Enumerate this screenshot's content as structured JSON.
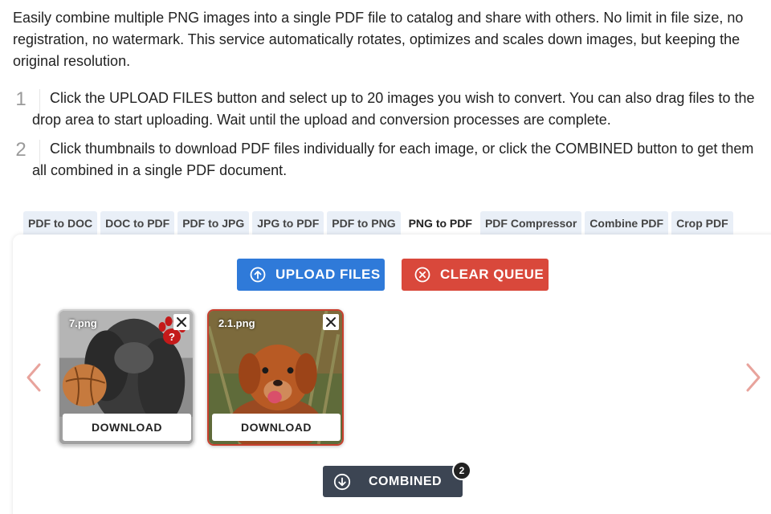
{
  "intro": "Easily combine multiple PNG images into a single PDF file to catalog and share with others. No limit in file size, no registration, no watermark. This service automatically rotates, optimizes and scales down images, but keeping the original resolution.",
  "steps": [
    {
      "num": "1",
      "text": "Click the UPLOAD FILES button and select up to 20 images you wish to convert. You can also drag files to the drop area to start uploading. Wait until the upload and conversion processes are complete."
    },
    {
      "num": "2",
      "text": "Click thumbnails to download PDF files individually for each image, or click the COMBINED button to get them all combined in a single PDF document."
    }
  ],
  "tabs": [
    {
      "label": "PDF to DOC",
      "active": false
    },
    {
      "label": "DOC to PDF",
      "active": false
    },
    {
      "label": "PDF to JPG",
      "active": false
    },
    {
      "label": "JPG to PDF",
      "active": false
    },
    {
      "label": "PDF to PNG",
      "active": false
    },
    {
      "label": "PNG to PDF",
      "active": true
    },
    {
      "label": "PDF Compressor",
      "active": false
    },
    {
      "label": "Combine PDF",
      "active": false
    },
    {
      "label": "Crop PDF",
      "active": false
    }
  ],
  "buttons": {
    "upload": {
      "label": "UPLOAD FILES",
      "icon": "upload-circle-icon",
      "color": "#2f7ad9"
    },
    "clear": {
      "label": "CLEAR QUEUE",
      "icon": "close-circle-icon",
      "color": "#d9483b"
    },
    "combined": {
      "label": "COMBINED",
      "icon": "download-circle-icon",
      "color": "#3c4553",
      "badge": "2"
    }
  },
  "files": [
    {
      "name": "7.png",
      "download_label": "DOWNLOAD",
      "status_icon": "paw-question-icon"
    },
    {
      "name": "2.1.png",
      "download_label": "DOWNLOAD"
    }
  ],
  "nav": {
    "prev_icon": "chevron-left-icon",
    "next_icon": "chevron-right-icon"
  }
}
